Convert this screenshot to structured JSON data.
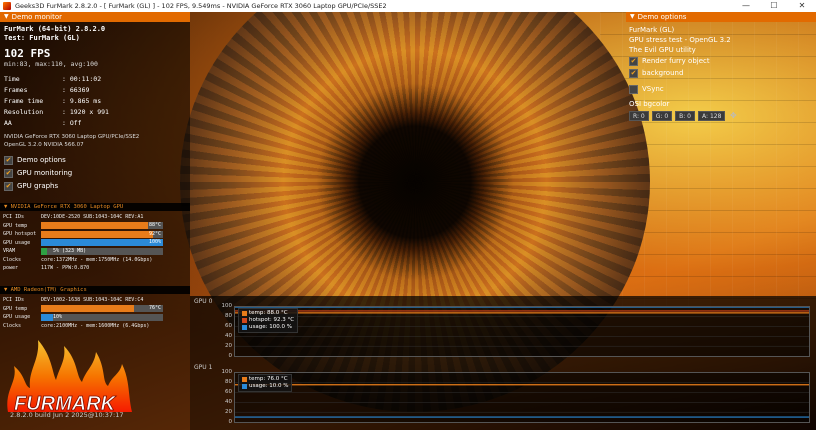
{
  "window": {
    "title": "Geeks3D FurMark 2.8.2.0 - [ FurMark (GL) ] - 102 FPS, 9.549ms - NVIDIA GeForce RTX 3060 Laptop GPU/PCIe/SSE2",
    "minimize": "—",
    "maximize": "☐",
    "close": "✕"
  },
  "demo_monitor": {
    "header": "Demo monitor",
    "app": "FurMark (64-bit) 2.8.2.0",
    "test": "Test: FurMark (GL)",
    "fps": "102 FPS",
    "minmax": "min:83, max:110, avg:100",
    "stats": [
      {
        "label": "Time",
        "value": ": 00:11:02"
      },
      {
        "label": "Frames",
        "value": ": 66369"
      },
      {
        "label": "Frame time",
        "value": ": 9.865 ms"
      },
      {
        "label": "Resolution",
        "value": ": 1920 x 991"
      },
      {
        "label": "AA",
        "value": ": Off"
      }
    ],
    "gpu_line1": "NVIDIA GeForce RTX 3060 Laptop GPU/PCIe/SSE2",
    "gpu_line2": "OpenGL 3.2.0 NVIDIA 566.07",
    "checks": [
      {
        "label": "Demo options",
        "checked": true
      },
      {
        "label": "GPU monitoring",
        "checked": true
      },
      {
        "label": "GPU graphs",
        "checked": true
      }
    ]
  },
  "gpu0": {
    "header": "NVIDIA GeForce RTX 3060 Laptop GPU",
    "pci_label": "PCI IDs",
    "pci_value": "DEV:10DE-2520 SUB:1043-104C REV:A1",
    "temp_label": "GPU temp",
    "temp_value": "88°C",
    "temp_pct": 0.88,
    "hotspot_label": "GPU hotspot",
    "hotspot_value": "92°C",
    "hotspot_pct": 0.92,
    "usage_label": "GPU usage",
    "usage_value": "100%",
    "usage_pct": 1.0,
    "vram_label": "VRAM",
    "vram_value": "5% (323 MB)",
    "vram_pct": 0.05,
    "clocks_label": "Clocks",
    "clocks_value": "core:1372MHz - mem:1750MHz (14.0Gbps)",
    "power_label": "power",
    "power_value": "117W - PPW:0.870"
  },
  "gpu1": {
    "header": "AMD Radeon(TM) Graphics",
    "pci_label": "PCI IDs",
    "pci_value": "DEV:1002-1638 SUB:1043-104C REV:C4",
    "temp_label": "GPU temp",
    "temp_value": "76°C",
    "temp_pct": 0.76,
    "usage_label": "GPU usage",
    "usage_value": "10%",
    "usage_pct": 0.1,
    "clocks_label": "Clocks",
    "clocks_value": "core:2100MHz - mem:1600MHz (6.4Gbps)"
  },
  "logo": {
    "text": "FURMARK"
  },
  "build": "2.8.2.0 build Jun  2 2025@10:37:17",
  "demo_options": {
    "header": "Demo options",
    "line1": "FurMark (GL)",
    "line2": "GPU stress test - OpenGL 3.2",
    "line3": "The Evil GPU utility",
    "checks": [
      {
        "label": "Render furry object",
        "checked": true
      },
      {
        "label": "background",
        "checked": true
      }
    ],
    "vsync": {
      "label": "VSync",
      "checked": false
    },
    "osi_label": "OSI bgcolor",
    "osi": {
      "r": "R:  0",
      "g": "G:  0",
      "b": "B:  0",
      "a": "A: 128"
    }
  },
  "graph0": {
    "title": "GPU 0",
    "yticks": [
      "100",
      "80",
      "60",
      "40",
      "20",
      "0"
    ],
    "legend": [
      {
        "label": "temp: 88.0 °C",
        "color": "#e87c1a"
      },
      {
        "label": "hotspot: 92.3 °C",
        "color": "#d4461a"
      },
      {
        "label": "usage: 100.0 %",
        "color": "#2b8ad8"
      }
    ],
    "series": {
      "temp": 88,
      "hotspot": 92,
      "usage": 100
    }
  },
  "graph1": {
    "title": "GPU 1",
    "yticks": [
      "100",
      "80",
      "60",
      "40",
      "20",
      "0"
    ],
    "legend": [
      {
        "label": "temp: 76.0 °C",
        "color": "#e87c1a"
      },
      {
        "label": "usage: 10.0 %",
        "color": "#2b8ad8"
      }
    ],
    "series": {
      "temp": 76,
      "usage": 10
    }
  },
  "colors": {
    "accent": "#e26a00",
    "temp": "#e87c1a",
    "hotspot": "#d4461a",
    "usage": "#2b8ad8",
    "vram": "#2ea043"
  }
}
